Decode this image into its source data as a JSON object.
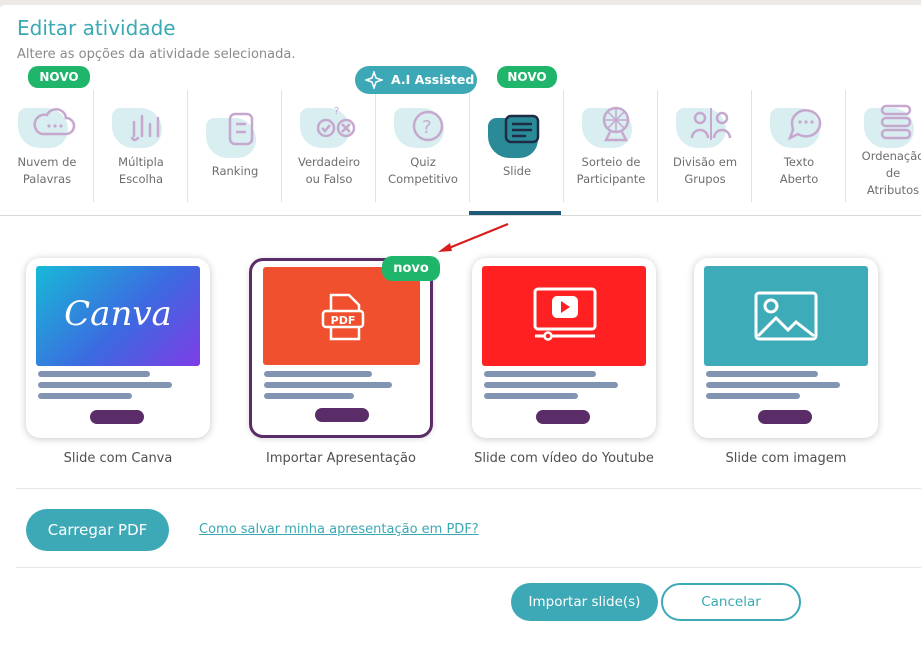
{
  "header": {
    "title": "Editar atividade",
    "subtitle": "Altere as opções da atividade selecionada."
  },
  "tabs": [
    {
      "label": "Nuvem de\nPalavras",
      "icon": "cloud-icon"
    },
    {
      "label": "Múltipla\nEscolha",
      "icon": "bars-icon"
    },
    {
      "label": "Ranking",
      "icon": "ranking-icon"
    },
    {
      "label": "Verdadeiro\nou Falso",
      "icon": "true-false-icon"
    },
    {
      "label": "Quiz\nCompetitivo",
      "icon": "quiz-icon"
    },
    {
      "label": "Slide",
      "icon": "slide-icon",
      "active": true
    },
    {
      "label": "Sorteio de\nParticipante",
      "icon": "wheel-icon"
    },
    {
      "label": "Divisão em\nGrupos",
      "icon": "groups-icon"
    },
    {
      "label": "Texto\nAberto",
      "icon": "chat-icon"
    },
    {
      "label": "Ordenação\nde\nAtributos",
      "icon": "sort-icon"
    }
  ],
  "badges": {
    "novo_1": "NOVO",
    "ai": "A.I Assisted",
    "novo_2": "NOVO",
    "novo_card": "novo"
  },
  "cards": [
    {
      "label": "Slide com Canva",
      "thumb_text": "Canva"
    },
    {
      "label": "Importar Apresentação",
      "thumb_text": "PDF"
    },
    {
      "label": "Slide com vídeo do Youtube",
      "thumb_text": ""
    },
    {
      "label": "Slide com imagem",
      "thumb_text": ""
    }
  ],
  "actions": {
    "upload": "Carregar PDF",
    "help_link": "Como salvar minha apresentação em PDF?",
    "import": "Importar slide(s)",
    "cancel": "Cancelar"
  },
  "colors": {
    "primary": "#3ea9b6",
    "badge_green": "#1fb56b",
    "selected_border": "#5a2d68",
    "active_tab": "#1f5a78"
  }
}
